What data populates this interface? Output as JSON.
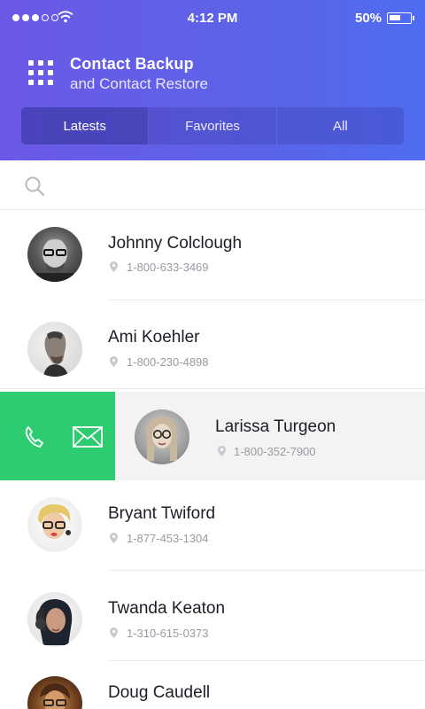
{
  "status": {
    "time": "4:12 PM",
    "battery": "50%",
    "battery_level": 0.5,
    "signal_bars": 3
  },
  "header": {
    "title": "Contact Backup",
    "subtitle": "and Contact Restore"
  },
  "tabs": [
    {
      "label": "Latests",
      "active": true
    },
    {
      "label": "Favorites",
      "active": false
    },
    {
      "label": "All",
      "active": false
    }
  ],
  "contacts": [
    {
      "name": "Johnny Colclough",
      "phone": "1-800-633-3469"
    },
    {
      "name": "Ami Koehler",
      "phone": "1-800-230-4898"
    },
    {
      "name": "Larissa Turgeon",
      "phone": "1-800-352-7900"
    },
    {
      "name": "Bryant Twiford",
      "phone": "1-877-453-1304"
    },
    {
      "name": "Twanda Keaton",
      "phone": "1-310-615-0373"
    },
    {
      "name": "Doug Caudell",
      "phone": ""
    }
  ],
  "colors": {
    "header_start": "#6b59e6",
    "header_end": "#4f6df0",
    "swipe_action": "#2ecc71"
  },
  "icons": {
    "menu": "grid-icon",
    "search": "search-icon",
    "call": "phone-icon",
    "message": "mail-icon",
    "location": "pin-icon"
  }
}
